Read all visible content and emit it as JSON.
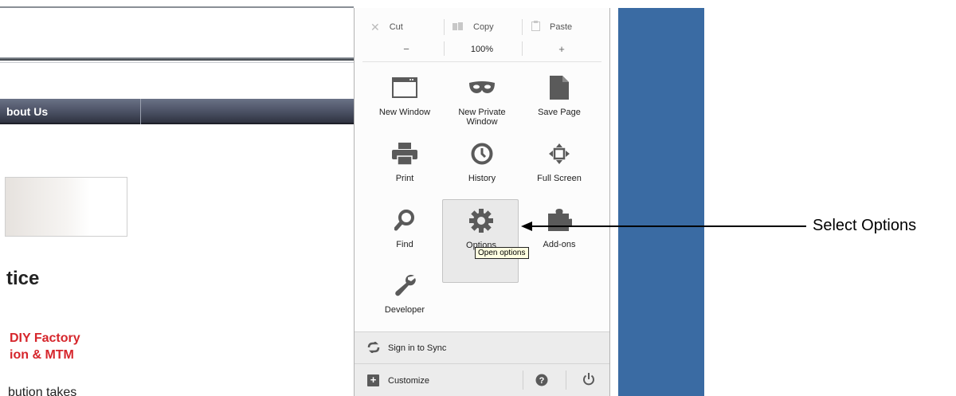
{
  "background_page": {
    "nav_label": "bout Us",
    "heading": "tice",
    "red_lines": [
      "DIY Factory",
      "ion & MTM"
    ],
    "body_text": "bution takes"
  },
  "menu": {
    "edit": {
      "cut": "Cut",
      "copy": "Copy",
      "paste": "Paste"
    },
    "zoom": {
      "minus": "−",
      "level": "100%",
      "plus": "+"
    },
    "tiles": [
      {
        "label": "New Window",
        "icon": "window-icon"
      },
      {
        "label": "New Private Window",
        "icon": "mask-icon"
      },
      {
        "label": "Save Page",
        "icon": "page-icon"
      },
      {
        "label": "Print",
        "icon": "printer-icon"
      },
      {
        "label": "History",
        "icon": "clock-icon"
      },
      {
        "label": "Full Screen",
        "icon": "fullscreen-icon"
      },
      {
        "label": "Find",
        "icon": "magnifier-icon"
      },
      {
        "label": "Options",
        "icon": "gear-icon"
      },
      {
        "label": "Add-ons",
        "icon": "puzzle-icon"
      },
      {
        "label": "Developer",
        "icon": "wrench-icon"
      }
    ],
    "tooltip": "Open options",
    "sync_label": "Sign in to Sync",
    "customize_label": "Customize"
  },
  "annotation": {
    "text": "Select Options"
  },
  "colors": {
    "blue_strip": "#3a6ba3",
    "nav_bar": "#4a5063",
    "red_text": "#d6262c"
  }
}
